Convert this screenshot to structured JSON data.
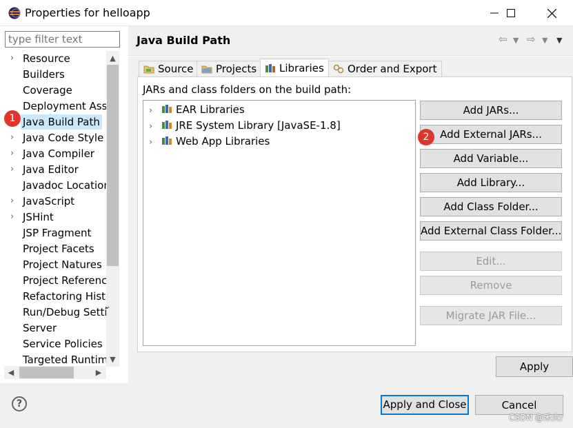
{
  "window": {
    "title": "Properties for helloapp",
    "minimize_glyph": "—",
    "maximize_glyph": "☐",
    "close_glyph": "✕"
  },
  "filter": {
    "placeholder": "type filter text"
  },
  "nav": {
    "items": [
      {
        "label": "Resource",
        "expandable": true
      },
      {
        "label": "Builders",
        "expandable": false
      },
      {
        "label": "Coverage",
        "expandable": false
      },
      {
        "label": "Deployment Ass",
        "expandable": false
      },
      {
        "label": "Java Build Path",
        "expandable": false,
        "selected": true
      },
      {
        "label": "Java Code Style",
        "expandable": true
      },
      {
        "label": "Java Compiler",
        "expandable": true
      },
      {
        "label": "Java Editor",
        "expandable": true
      },
      {
        "label": "Javadoc Locatior",
        "expandable": false
      },
      {
        "label": "JavaScript",
        "expandable": true
      },
      {
        "label": "JSHint",
        "expandable": true
      },
      {
        "label": "JSP Fragment",
        "expandable": false
      },
      {
        "label": "Project Facets",
        "expandable": false
      },
      {
        "label": "Project Natures",
        "expandable": false
      },
      {
        "label": "Project Referenc",
        "expandable": false
      },
      {
        "label": "Refactoring Histe",
        "expandable": false
      },
      {
        "label": "Run/Debug Setti",
        "expandable": false
      },
      {
        "label": "Server",
        "expandable": false
      },
      {
        "label": "Service Policies",
        "expandable": false
      },
      {
        "label": "Targeted Runtim",
        "expandable": false
      }
    ]
  },
  "page": {
    "title": "Java Build Path"
  },
  "tabs": [
    {
      "label": "Source",
      "icon": "source-folder-icon"
    },
    {
      "label": "Projects",
      "icon": "projects-icon"
    },
    {
      "label": "Libraries",
      "icon": "libraries-icon",
      "active": true
    },
    {
      "label": "Order and Export",
      "icon": "order-export-icon"
    }
  ],
  "libraries": {
    "caption": "JARs and class folders on the build path:",
    "entries": [
      {
        "label": "EAR Libraries"
      },
      {
        "label": "JRE System Library [JavaSE-1.8]"
      },
      {
        "label": "Web App Libraries"
      }
    ]
  },
  "buttons": {
    "add_jars": "Add JARs...",
    "add_external_jars": "Add External JARs...",
    "add_variable": "Add Variable...",
    "add_library": "Add Library...",
    "add_class_folder": "Add Class Folder...",
    "add_external_class_folder": "Add External Class Folder...",
    "edit": "Edit...",
    "remove": "Remove",
    "migrate_jar": "Migrate JAR File...",
    "apply": "Apply",
    "apply_and_close": "Apply and Close",
    "cancel": "Cancel"
  },
  "annotations": {
    "badge_1": "1",
    "badge_2": "2"
  },
  "help_glyph": "?",
  "watermark": "CSDN @禾火r",
  "colors": {
    "selection": "#cce8ff",
    "badge": "#e0352b",
    "default_button_border": "#0078d7"
  }
}
